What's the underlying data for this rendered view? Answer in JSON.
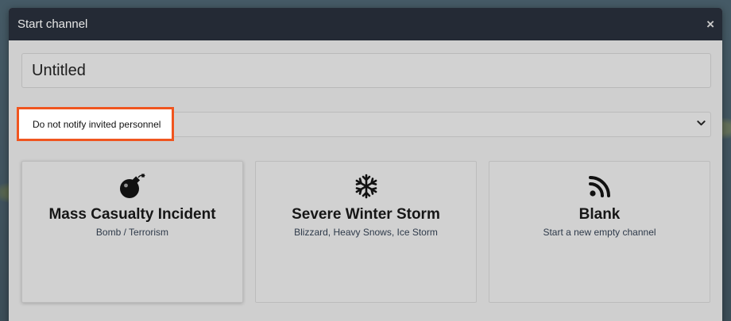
{
  "modal": {
    "title": "Start channel",
    "close_label": "×"
  },
  "form": {
    "channel_name_value": "Untitled",
    "notify_select": {
      "selected": "Do not notify invited personnel"
    }
  },
  "templates": [
    {
      "title": "Mass Casualty Incident",
      "subtitle": "Bomb / Terrorism",
      "icon": "bomb-icon"
    },
    {
      "title": "Severe Winter Storm",
      "subtitle": "Blizzard, Heavy Snows, Ice Storm",
      "icon": "snowflake-icon"
    },
    {
      "title": "Blank",
      "subtitle": "Start a new empty channel",
      "icon": "rss-icon"
    }
  ],
  "colors": {
    "header_bg": "#242a35",
    "modal_bg": "#cfcfcf",
    "highlight_border": "#f0551f"
  }
}
